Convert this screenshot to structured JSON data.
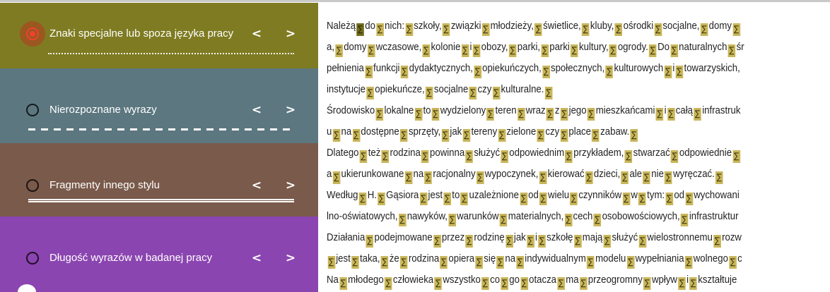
{
  "sidebar": {
    "sections": [
      {
        "label": "Znaki specjalne lub spoza języka pracy",
        "selected": true,
        "color": "#7f7b22",
        "prev": "<",
        "next": ">"
      },
      {
        "label": "Nierozpoznane wyrazy",
        "selected": false,
        "color": "#5c7780",
        "prev": "<",
        "next": ">"
      },
      {
        "label": "Fragmenty innego stylu",
        "selected": false,
        "color": "#7a5a4b",
        "prev": "<",
        "next": ">"
      },
      {
        "label": "Długość wyrazów w badanej pracy",
        "selected": false,
        "color": "#8b45b0",
        "prev": "<",
        "next": ">"
      }
    ],
    "selected_radio_color": "#f0412f"
  },
  "document": {
    "marker_glyph": "∑",
    "marker_color": "#c9b65a",
    "active_marker_color": "#716b1d",
    "active_marker_index": 0,
    "lines": [
      "Należą∑do∑nich:∑szkoły,∑związki∑młodzieży,∑świetlice,∑kluby,∑ośrodki∑socjalne,∑domy∑",
      "a,∑domy∑wczasowe,∑kolonie∑i∑obozy,∑parki,∑parki∑kultury,∑ogrody.∑Do∑naturalnych∑śr",
      "pełnienia∑funkcji∑dydaktycznych,∑opiekuńczych,∑społecznych,∑kulturowych∑i∑towarzyskich,",
      "instytucje∑opiekuńcze,∑socjalne∑czy∑kulturalne.∑",
      "Środowisko∑lokalne∑to∑wydzielony∑teren∑wraz∑z∑jego∑mieszkańcami∑i∑całą∑infrastruk",
      "u∑na∑dostępne∑sprzęty,∑jak∑tereny∑zielone∑czy∑place∑zabaw.∑",
      "Dlatego∑też∑rodzina∑powinna∑służyć∑odpowiednim∑przykładem,∑stwarzać∑odpowiednie∑",
      "a∑ukierunkowane∑na∑racjonalny∑wypoczynek,∑kierować∑dzieci,∑ale∑nie∑wyręczać.∑",
      "Według∑H.∑Gąsiora∑jest∑to∑uzależnione∑od∑wielu∑czynników∑w∑tym:∑od∑wychowani",
      "lno-oświatowych,∑nawyków,∑warunków∑materialnych,∑cech∑osobowościowych,∑infrastruktur",
      "Działania∑podejmowane∑przez∑rodzinę∑jak∑i∑szkołę∑mają∑służyć∑wielostronnemu∑rozw",
      "∑jest∑taka,∑że∑rodzina∑opiera∑się∑na∑indywidualnym∑modelu∑wypełniania∑wolnego∑c",
      "Na∑młodego∑człowieka∑wszystko∑co∑go∑otacza∑ma∑przeogromny∑wpływ∑i∑kształtuje"
    ]
  }
}
